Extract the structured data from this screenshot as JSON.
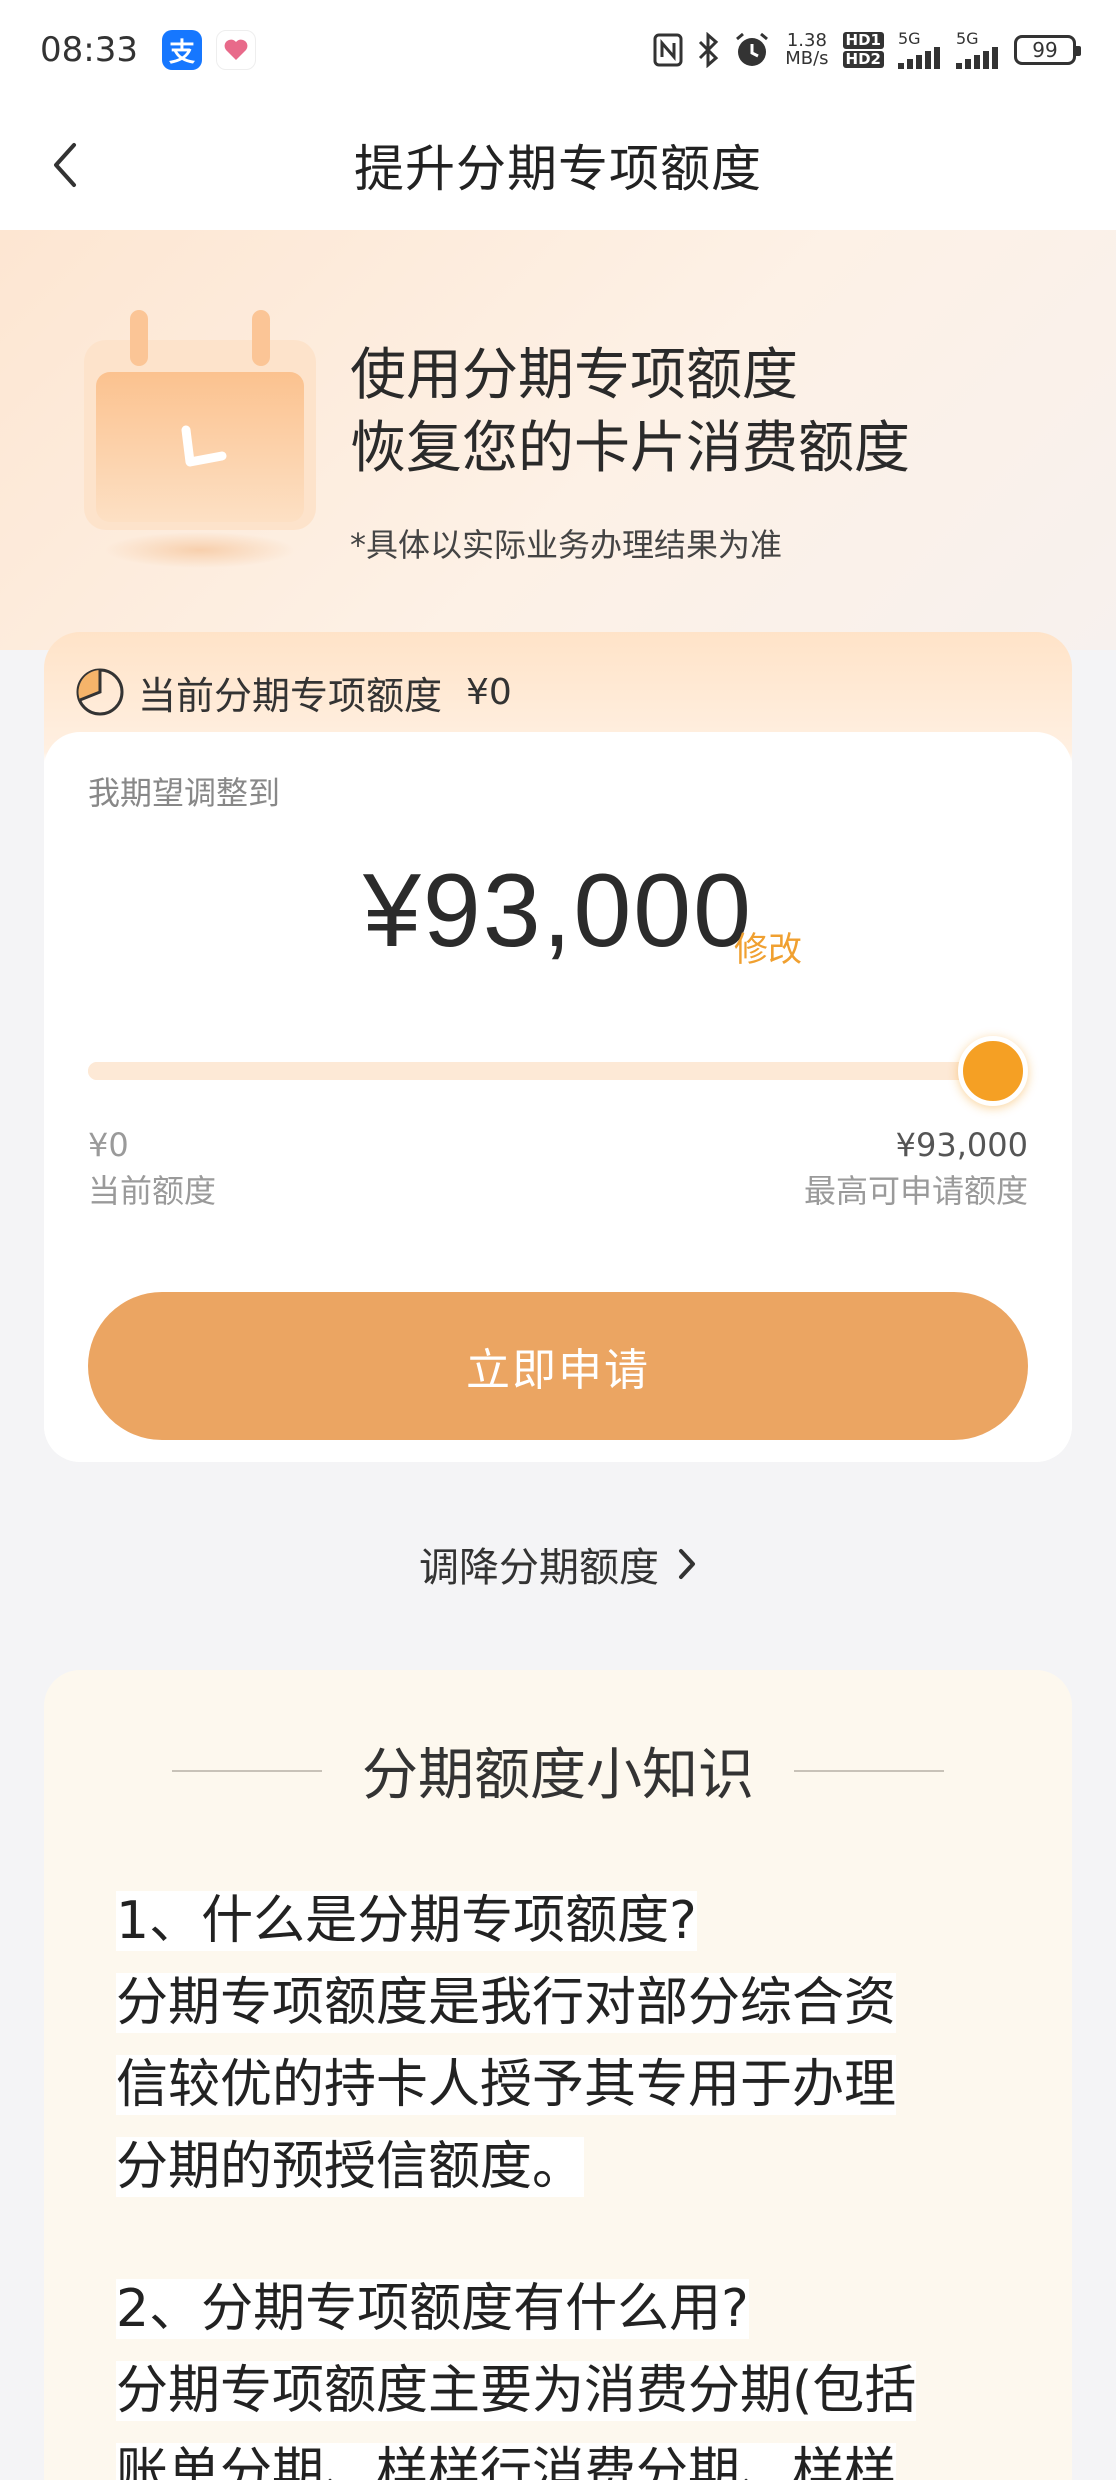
{
  "status_bar": {
    "time": "08:33",
    "speed": "1.38",
    "speed_unit": "MB/s",
    "hd1": "HD1",
    "hd2": "HD2",
    "net1": "5G",
    "net2": "5G",
    "battery": "99"
  },
  "nav": {
    "title": "提升分期专项额度"
  },
  "hero": {
    "title_line1": "使用分期专项额度",
    "title_line2": "恢复您的卡片消费额度",
    "note": "*具体以实际业务办理结果为准"
  },
  "quota": {
    "current_label": "当前分期专项额度",
    "current_value": "¥0",
    "expect_label": "我期望调整到",
    "amount": "¥93,000",
    "modify_label": "修改",
    "slider_level": 1.0,
    "min_value": "¥0",
    "min_label": "当前额度",
    "max_value": "¥93,000",
    "max_label": "最高可申请额度",
    "apply_label": "立即申请"
  },
  "reduce": {
    "label": "调降分期额度"
  },
  "knowledge": {
    "title": "分期额度小知识",
    "q1": "1、什么是分期专项额度?",
    "a1_line1": "分期专项额度是我行对部分综合资",
    "a1_line2": "信较优的持卡人授予其专用于办理",
    "a1_line3": "分期的预授信额度。",
    "q2": "2、分期专项额度有什么用?",
    "a2_line1": "分期专项额度主要为消费分期(包括",
    "a2_line2": "账单分期、样样行消费分期、样样"
  },
  "colors": {
    "accent": "#f5a024",
    "button": "#eba562",
    "modify": "#f0a030"
  }
}
